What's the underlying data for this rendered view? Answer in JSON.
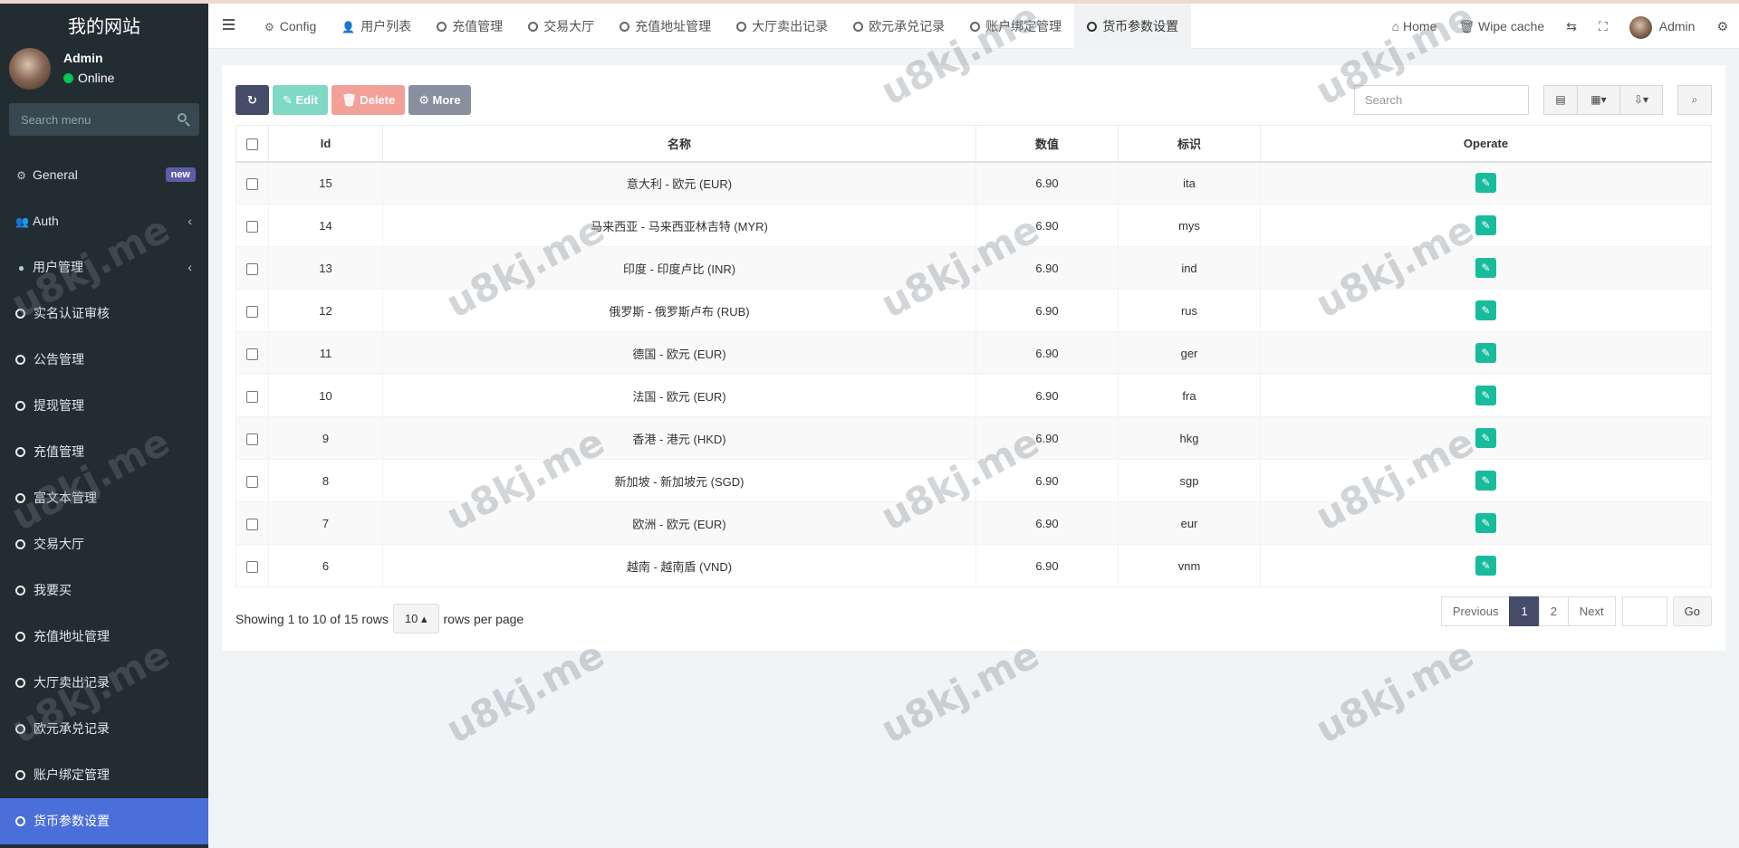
{
  "sidebar": {
    "logo": "我的网站",
    "user": {
      "name": "Admin",
      "status": "Online"
    },
    "search_placeholder": "Search menu",
    "items": [
      {
        "label": "General",
        "badge": "new"
      },
      {
        "label": "Auth"
      },
      {
        "label": "用户管理"
      },
      {
        "label": "实名认证审核"
      },
      {
        "label": "公告管理"
      },
      {
        "label": "提现管理"
      },
      {
        "label": "充值管理"
      },
      {
        "label": "富文本管理"
      },
      {
        "label": "交易大厅"
      },
      {
        "label": "我要买"
      },
      {
        "label": "充值地址管理"
      },
      {
        "label": "大厅卖出记录"
      },
      {
        "label": "欧元承兑记录"
      },
      {
        "label": "账户绑定管理"
      },
      {
        "label": "货币参数设置"
      }
    ]
  },
  "topbar": {
    "tabs": [
      "Config",
      "用户列表",
      "充值管理",
      "交易大厅",
      "充值地址管理",
      "大厅卖出记录",
      "欧元承兑记录",
      "账户绑定管理",
      "货币参数设置"
    ],
    "home": "Home",
    "wipe_cache": "Wipe cache",
    "admin": "Admin"
  },
  "toolbar": {
    "edit": "Edit",
    "delete": "Delete",
    "more": "More",
    "search_placeholder": "Search"
  },
  "table": {
    "headers": [
      "Id",
      "名称",
      "数值",
      "标识",
      "Operate"
    ],
    "rows": [
      [
        "15",
        "意大利 - 欧元 (EUR)",
        "6.90",
        "ita"
      ],
      [
        "14",
        "马来西亚 - 马来西亚林吉特 (MYR)",
        "6.90",
        "mys"
      ],
      [
        "13",
        "印度 - 印度卢比 (INR)",
        "6.90",
        "ind"
      ],
      [
        "12",
        "俄罗斯 - 俄罗斯卢布 (RUB)",
        "6.90",
        "rus"
      ],
      [
        "11",
        "德国 - 欧元 (EUR)",
        "6.90",
        "ger"
      ],
      [
        "10",
        "法国 - 欧元 (EUR)",
        "6.90",
        "fra"
      ],
      [
        "9",
        "香港 - 港元 (HKD)",
        "6.90",
        "hkg"
      ],
      [
        "8",
        "新加坡 - 新加坡元 (SGD)",
        "6.90",
        "sgp"
      ],
      [
        "7",
        "欧洲 - 欧元 (EUR)",
        "6.90",
        "eur"
      ],
      [
        "6",
        "越南 - 越南盾 (VND)",
        "6.90",
        "vnm"
      ]
    ]
  },
  "pagination": {
    "showing": "Showing 1 to 10 of 15 rows",
    "page_size": "10",
    "rows_per_page": "rows per page",
    "previous": "Previous",
    "pages": [
      "1",
      "2"
    ],
    "next": "Next",
    "go": "Go"
  },
  "watermark": "u8kj.me",
  "colors": {
    "sidebar_bg": "#222d32",
    "active_menu": "#4a6fd8",
    "primary": "#444c69",
    "operate": "#18bc9c"
  }
}
